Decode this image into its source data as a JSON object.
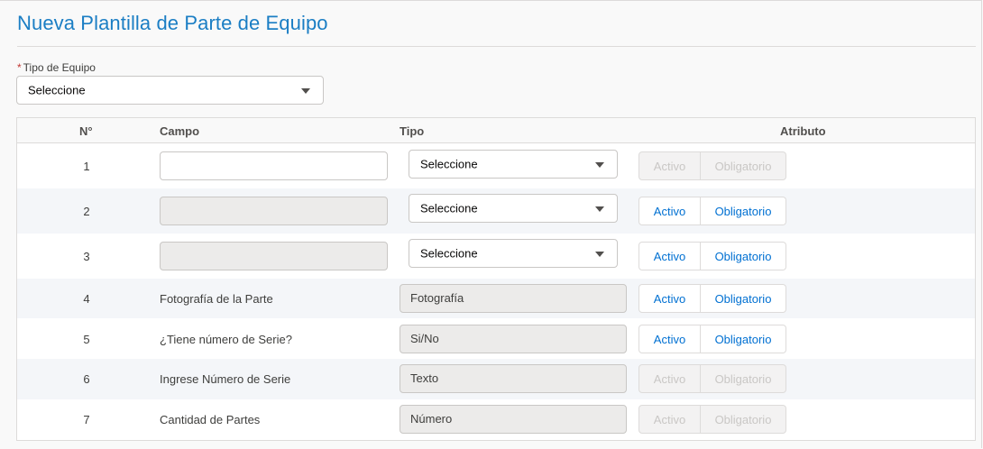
{
  "page": {
    "title": "Nueva Plantilla de Parte de Equipo"
  },
  "equipment_type": {
    "required_mark": "*",
    "label": "Tipo de Equipo",
    "value": "Seleccione"
  },
  "table": {
    "headers": {
      "num": "N°",
      "field": "Campo",
      "type": "Tipo",
      "attribute": "Atributo"
    },
    "buttons": {
      "active": "Activo",
      "required": "Obligatorio"
    },
    "rows": [
      {
        "num": "1",
        "field": "",
        "type": "Seleccione",
        "field_editable": true,
        "type_editable": true,
        "buttons_enabled": false
      },
      {
        "num": "2",
        "field": "",
        "type": "Seleccione",
        "field_editable": false,
        "type_editable": true,
        "buttons_enabled": true
      },
      {
        "num": "3",
        "field": "",
        "type": "Seleccione",
        "field_editable": false,
        "type_editable": true,
        "buttons_enabled": true
      },
      {
        "num": "4",
        "field": "Fotografía de la Parte",
        "type": "Fotografía",
        "type_editable": false,
        "buttons_enabled": true
      },
      {
        "num": "5",
        "field": "¿Tiene número de Serie?",
        "type": "Si/No",
        "type_editable": false,
        "buttons_enabled": true
      },
      {
        "num": "6",
        "field": "Ingrese Número de Serie",
        "type": "Texto",
        "type_editable": false,
        "buttons_enabled": false
      },
      {
        "num": "7",
        "field": "Cantidad de Partes",
        "type": "Número",
        "type_editable": false,
        "buttons_enabled": false
      }
    ]
  }
}
